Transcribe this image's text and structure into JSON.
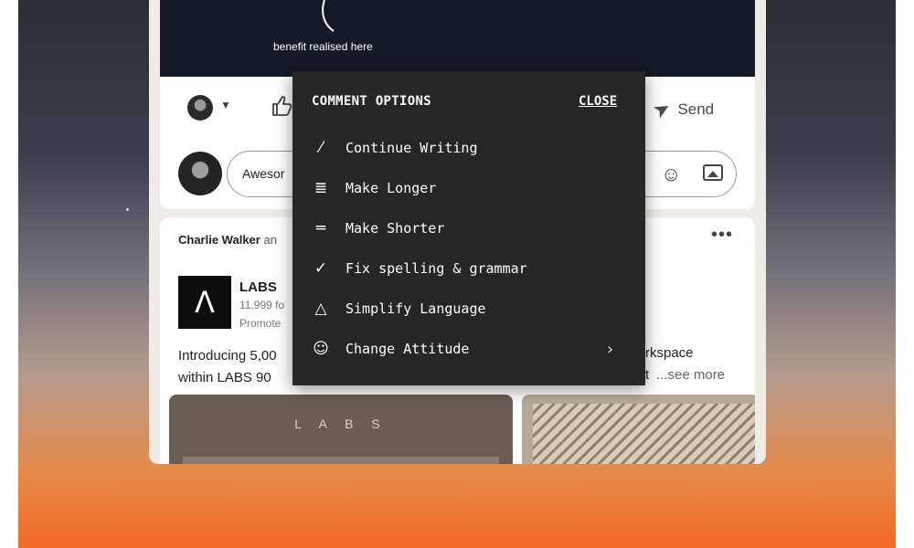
{
  "hero": {
    "caption": "benefit realised here"
  },
  "actions": {
    "send_label": "Send",
    "send_icon": "send-icon"
  },
  "comment": {
    "draft_text": "Awesor"
  },
  "post": {
    "social_name": "Charlie Walker",
    "social_suffix": "an",
    "company": "LABS",
    "followers": "11,999 fo",
    "promoted": "Promote",
    "text_line1": "Introducing 5,00",
    "text_line2": "within LABS 90",
    "text_right1": "rkspace",
    "text_right2": "t",
    "see_more": "...see more",
    "image_label": "L A B S"
  },
  "popup": {
    "title": "COMMENT OPTIONS",
    "close_label": "CLOSE",
    "items": [
      {
        "label": "Continue Writing",
        "icon": "magic-wand-icon"
      },
      {
        "label": "Make Longer",
        "icon": "text-long-icon"
      },
      {
        "label": "Make Shorter",
        "icon": "text-short-icon"
      },
      {
        "label": "Fix spelling & grammar",
        "icon": "check-icon"
      },
      {
        "label": "Simplify Language",
        "icon": "shapes-icon"
      },
      {
        "label": "Change Attitude",
        "icon": "masks-icon"
      }
    ]
  }
}
